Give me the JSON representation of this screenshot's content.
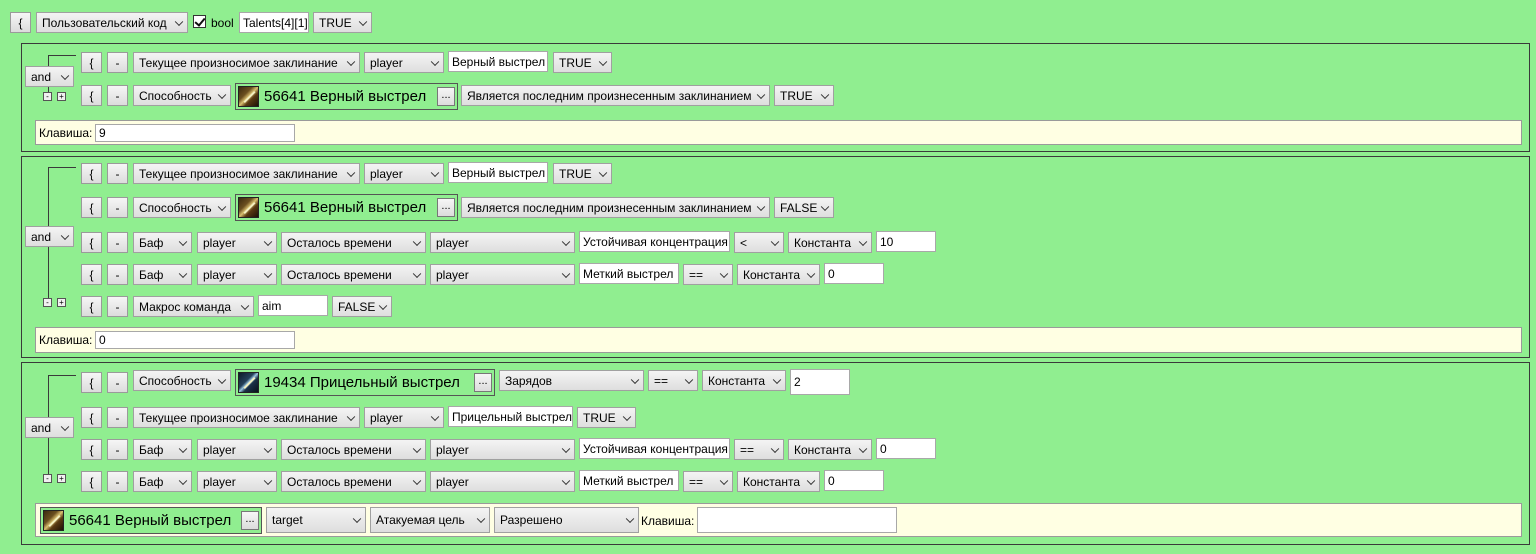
{
  "header": {
    "brace": "{",
    "type_select": "Пользовательский код",
    "bool_checked": true,
    "bool_label": "bool",
    "var_name": "Talents[4][1]",
    "value": "TRUE"
  },
  "common": {
    "brace": "{",
    "minus": "-",
    "key_label": "Клавиша:",
    "more": "...",
    "expand": "+",
    "collapse": "-"
  },
  "block1": {
    "logic": "and",
    "rows": [
      {
        "type": "Текущее произносимое заклинание",
        "unit": "player",
        "spell_name": "Верный выстрел",
        "value": "TRUE"
      },
      {
        "type": "Способность",
        "spell": "56641 Верный выстрел",
        "condition": "Является последним произнесенным заклинанием",
        "value": "TRUE"
      }
    ],
    "key_value": "9"
  },
  "block2": {
    "logic": "and",
    "rows": [
      {
        "type": "Текущее произносимое заклинание",
        "unit": "player",
        "spell_name": "Верный выстрел",
        "value": "TRUE"
      },
      {
        "type": "Способность",
        "spell": "56641 Верный выстрел",
        "condition": "Является последним произнесенным заклинанием",
        "value": "FALSE"
      },
      {
        "type": "Баф",
        "unit": "player",
        "prop": "Осталось времени",
        "caster": "player",
        "buff": "Устойчивая концентрация",
        "op": "<",
        "source": "Константа",
        "number": "10"
      },
      {
        "type": "Баф",
        "unit": "player",
        "prop": "Осталось времени",
        "caster": "player",
        "buff": "Меткий выстрел",
        "op": "==",
        "source": "Константа",
        "number": "0"
      },
      {
        "type": "Макрос команда",
        "macro": "aim",
        "value": "FALSE"
      }
    ],
    "key_value": "0"
  },
  "block3": {
    "logic": "and",
    "rows": [
      {
        "type": "Способность",
        "spell": "19434 Прицельный выстрел",
        "prop": "Зарядов",
        "op": "==",
        "source": "Константа",
        "number": "2"
      },
      {
        "type": "Текущее произносимое заклинание",
        "unit": "player",
        "spell_name": "Прицельный выстрел",
        "value": "TRUE"
      },
      {
        "type": "Баф",
        "unit": "player",
        "prop": "Осталось времени",
        "caster": "player",
        "buff": "Устойчивая концентрация",
        "op": "==",
        "source": "Константа",
        "number": "0"
      },
      {
        "type": "Баф",
        "unit": "player",
        "prop": "Осталось времени",
        "caster": "player",
        "buff": "Меткий выстрел",
        "op": "==",
        "source": "Константа",
        "number": "0"
      }
    ],
    "action": {
      "spell": "56641 Верный выстрел",
      "target": "target",
      "target_type": "Атакуемая цель",
      "permission": "Разрешено",
      "key_value": ""
    }
  }
}
